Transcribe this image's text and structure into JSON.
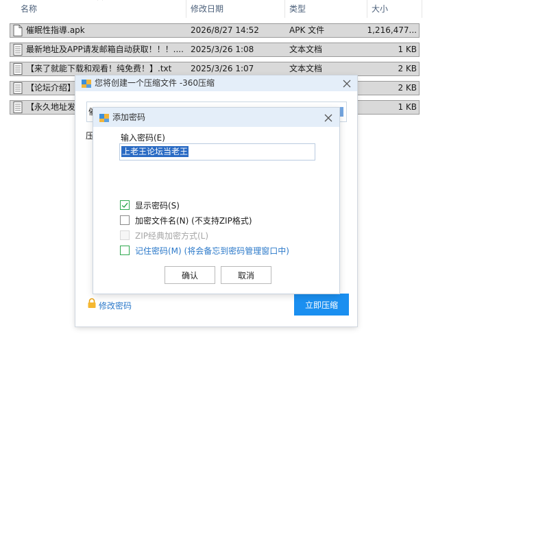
{
  "list_header": {
    "col_name": "名称",
    "col_date": "修改日期",
    "col_type": "类型",
    "col_size": "大小"
  },
  "files": [
    {
      "name": "催眠性指導.apk",
      "date": "2026/8/27 14:52",
      "type": "APK 文件",
      "size": "1,216,477..."
    },
    {
      "name": "最新地址及APP请发邮箱自动获取！！！....",
      "date": "2025/3/26 1:08",
      "type": "文本文档",
      "size": "1 KB"
    },
    {
      "name": "【来了就能下载和观看！纯免费！】.txt",
      "date": "2025/3/26 1:07",
      "type": "文本文档",
      "size": "2 KB"
    },
    {
      "name": "【论坛介绍】",
      "date": "",
      "type": "",
      "size": "2 KB"
    },
    {
      "name": "【永久地址发",
      "date": "",
      "type": "",
      "size": "1 KB"
    }
  ],
  "outer_dialog": {
    "title": "您将创建一个压缩文件 -360压缩",
    "path_value_visible": "催",
    "compress_label_visible": "压",
    "modify_password": "修改密码",
    "compress_now": "立即压缩"
  },
  "password_dialog": {
    "title": "添加密码",
    "input_label": "输入密码(E)",
    "password_value": "上老王论坛当老王",
    "show_password": {
      "label": "显示密码(S)",
      "checked": true
    },
    "encrypt_filename": {
      "label": "加密文件名(N) (不支持ZIP格式)",
      "checked": false
    },
    "zip_classic": {
      "label": "ZIP经典加密方式(L)",
      "checked": false,
      "disabled": true
    },
    "remember_password": {
      "label": "记住密码(M) (将会备忘到密码管理窗口中)",
      "checked": false
    },
    "ok": "确认",
    "cancel": "取消"
  },
  "colors": {
    "accent": "#1a8ff0",
    "link": "#2a78c9",
    "titlebar": "#e4eef9",
    "selection": "#2a6bc4",
    "check_green": "#2fa84f"
  }
}
